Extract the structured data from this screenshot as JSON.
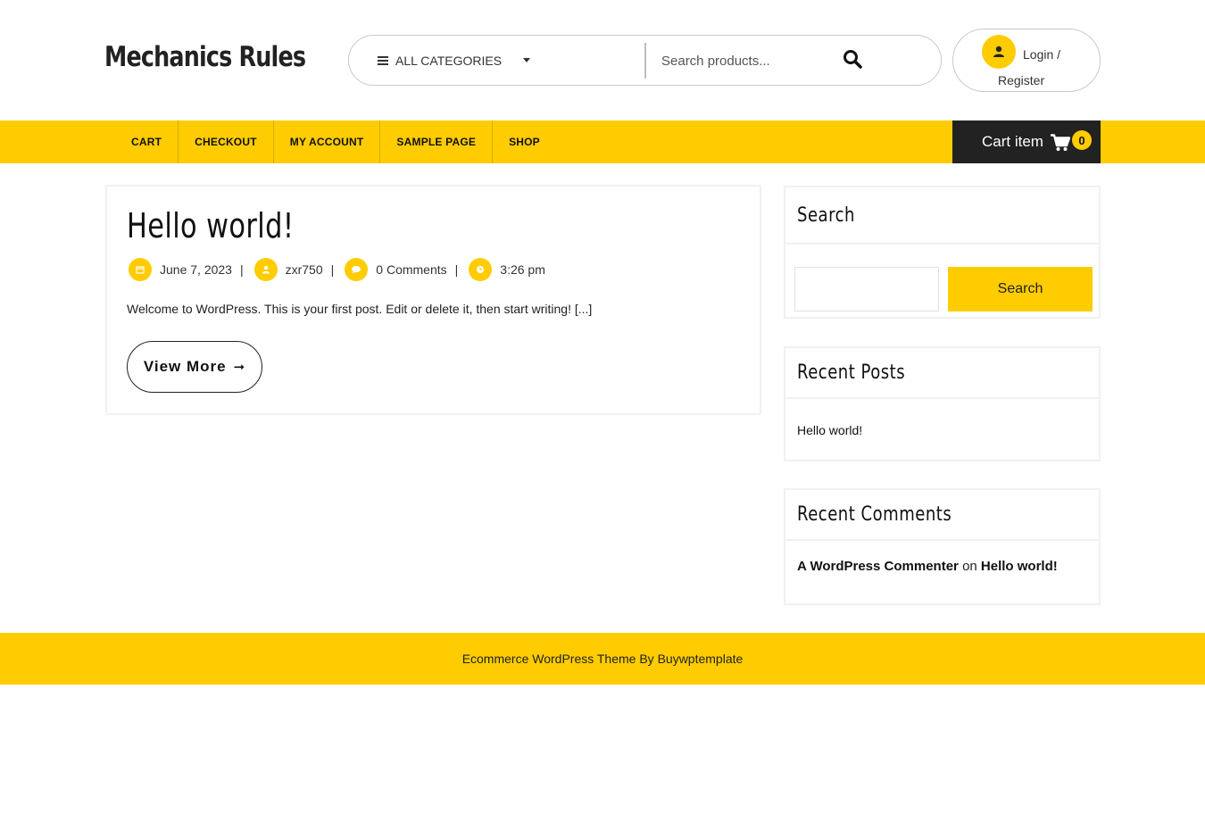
{
  "site": {
    "title": "Mechanics Rules"
  },
  "search": {
    "category_label": "ALL CATEGORIES",
    "placeholder": "Search products..."
  },
  "account": {
    "login_line1": "Login /",
    "login_line2": "Register"
  },
  "nav": {
    "items": [
      "CART",
      "CHECKOUT",
      "MY ACCOUNT",
      "SAMPLE PAGE",
      "SHOP"
    ],
    "cart_label": "Cart item",
    "cart_count": "0"
  },
  "post": {
    "title": "Hello world!",
    "date": "June 7, 2023",
    "author": "zxr750",
    "comments": "0 Comments",
    "time": "3:26 pm",
    "separator": "|",
    "excerpt": "Welcome to WordPress. This is your first post. Edit or delete it, then start writing! [...]",
    "read_more": "View More",
    "read_more_arrow": "➞"
  },
  "sidebar": {
    "search": {
      "title": "Search",
      "button": "Search"
    },
    "recent_posts": {
      "title": "Recent Posts",
      "items": [
        "Hello world!"
      ]
    },
    "recent_comments": {
      "title": "Recent Comments",
      "author": "A WordPress Commenter",
      "on": "on",
      "post": "Hello world!"
    }
  },
  "footer": {
    "text": "Ecommerce WordPress Theme By Buywptemplate"
  },
  "colors": {
    "accent": "#fecc00",
    "dark": "#222222",
    "border": "#f1f1f1"
  }
}
